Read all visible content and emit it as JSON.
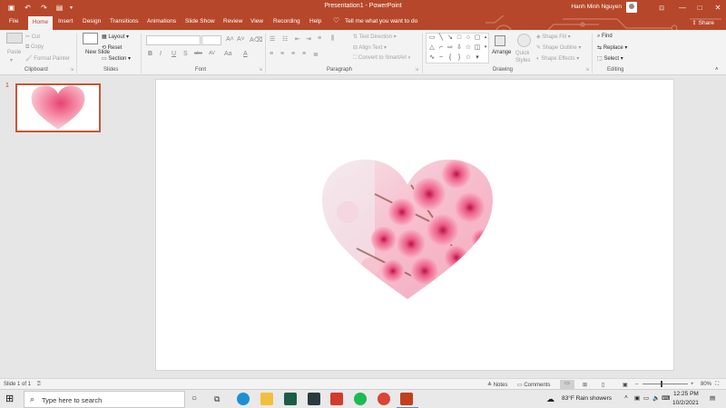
{
  "window": {
    "title": "Presentation1 - PowerPoint",
    "user_name": "Hanh Minh Nguyen",
    "controls": {
      "minimize": "—",
      "maximize": "□",
      "close": "✕"
    }
  },
  "tabs": [
    "File",
    "Home",
    "Insert",
    "Design",
    "Transitions",
    "Animations",
    "Slide Show",
    "Review",
    "View",
    "Recording",
    "Help"
  ],
  "tell_me": "Tell me what you want to do",
  "share_label": "Share",
  "ribbon": {
    "clipboard": {
      "paste": "Paste",
      "cut": "Cut",
      "copy": "Copy",
      "format_painter": "Format Painter",
      "label": "Clipboard"
    },
    "slides": {
      "new_slide": "New Slide",
      "layout": "Layout",
      "reset": "Reset",
      "section": "Section",
      "label": "Slides"
    },
    "font": {
      "bold": "B",
      "italic": "I",
      "underline": "U",
      "strike": "S",
      "shadow": "abc",
      "spacing": "AV",
      "case": "Aa",
      "label": "Font"
    },
    "paragraph": {
      "text_direction": "Text Direction",
      "align_text": "Align Text",
      "convert_smartart": "Convert to SmartArt",
      "label": "Paragraph"
    },
    "drawing": {
      "arrange": "Arrange",
      "quick_styles": "Quick Styles",
      "shape_fill": "Shape Fill",
      "shape_outline": "Shape Outline",
      "shape_effects": "Shape Effects",
      "label": "Drawing"
    },
    "editing": {
      "find": "Find",
      "replace": "Replace",
      "select": "Select",
      "label": "Editing"
    }
  },
  "slides_pane": {
    "slide_number": "1"
  },
  "status": {
    "slide_info": "Slide 1 of 1",
    "notes": "Notes",
    "comments": "Comments",
    "zoom": "80%"
  },
  "taskbar": {
    "search_placeholder": "Type here to search",
    "weather": "83°F  Rain showers",
    "time": "12:25 PM",
    "date": "10/2/2021"
  },
  "colors": {
    "accent": "#b7472a",
    "ribbon_bg": "#f3f3f3",
    "workspace_bg": "#e6e6e6"
  }
}
